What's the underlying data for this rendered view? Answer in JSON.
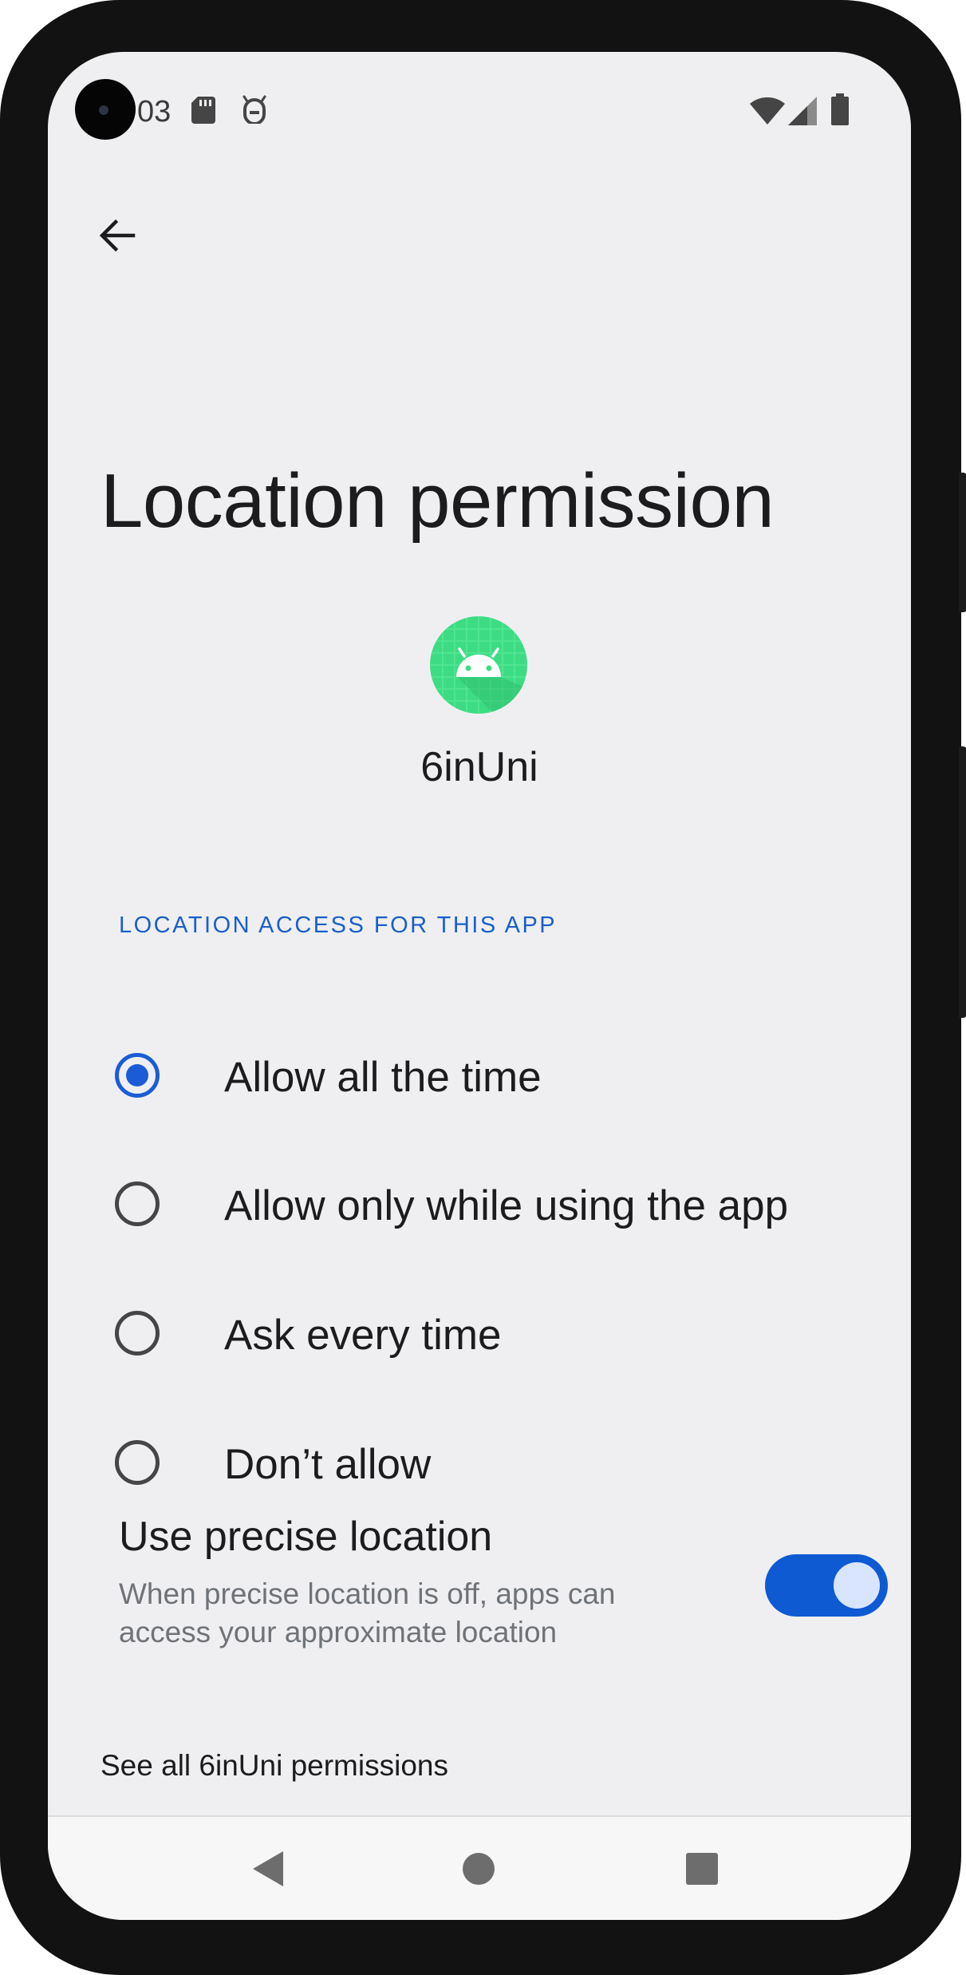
{
  "status_bar": {
    "time": "03",
    "icons": [
      "sd-card-icon",
      "android-debug-icon",
      "wifi-icon",
      "cell-signal-icon",
      "battery-icon"
    ]
  },
  "header": {
    "back_icon": "arrow-back-icon",
    "title": "Location permission"
  },
  "app": {
    "icon": "android-app-icon",
    "name": "6inUni",
    "icon_color": "#3ddc84"
  },
  "section": {
    "header": "LOCATION ACCESS FOR THIS APP"
  },
  "options": [
    {
      "label": "Allow all the time",
      "selected": true
    },
    {
      "label": "Allow only while using the app",
      "selected": false
    },
    {
      "label": "Ask every time",
      "selected": false
    },
    {
      "label": "Don’t allow",
      "selected": false
    }
  ],
  "precise_location": {
    "title": "Use precise location",
    "summary": "When precise location is off, apps can access your approximate location",
    "enabled": true
  },
  "footer": {
    "see_all": "See all 6inUni permissions"
  },
  "nav_bar": {
    "back_icon": "nav-back-icon",
    "home_icon": "nav-home-icon",
    "recents_icon": "nav-recents-icon"
  },
  "colors": {
    "accent": "#1b5cd6",
    "toggle_track": "#0e5ad2",
    "background": "#efeff1"
  }
}
